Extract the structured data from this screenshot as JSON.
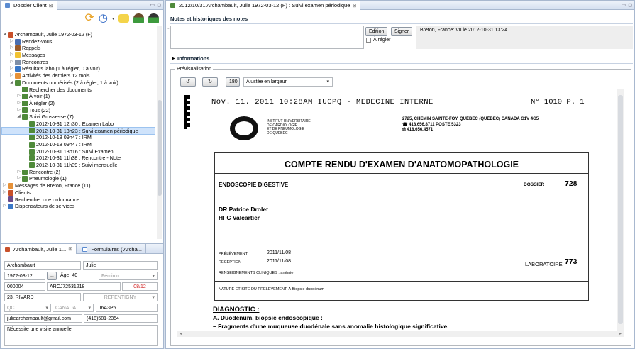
{
  "left_top": {
    "tab": "Dossier Client",
    "tab_close": "⊠",
    "tree": [
      {
        "depth": 0,
        "tw": "◢",
        "icon": "patient-icon",
        "color": "#c8502a",
        "label": "Archambault, Julie 1972-03-12 (F)"
      },
      {
        "depth": 1,
        "tw": "▷",
        "icon": "calendar-icon",
        "color": "#4a6fb1",
        "label": "Rendez-vous"
      },
      {
        "depth": 1,
        "tw": "▷",
        "icon": "pin-icon",
        "color": "#9a5b2a",
        "label": "Rappels"
      },
      {
        "depth": 1,
        "tw": "▷",
        "icon": "message-icon",
        "color": "#f1c232",
        "label": "Messages"
      },
      {
        "depth": 1,
        "tw": "▷",
        "icon": "calendar-icon",
        "color": "#7f8fa6",
        "label": "Rencontres"
      },
      {
        "depth": 1,
        "tw": "▷",
        "icon": "lab-icon",
        "color": "#3a78c7",
        "label": "Résultats labo (1 à régler, 0 à voir)"
      },
      {
        "depth": 1,
        "tw": "▷",
        "icon": "activity-icon",
        "color": "#e69138",
        "label": "Activités des derniers 12 mois"
      },
      {
        "depth": 1,
        "tw": "◢",
        "icon": "document-icon",
        "color": "#4f8a3a",
        "label": "Documents numérisés (2 à régler, 1 à voir)"
      },
      {
        "depth": 2,
        "tw": "",
        "icon": "search-document-icon",
        "color": "#4f8a3a",
        "label": "Rechercher des documents"
      },
      {
        "depth": 2,
        "tw": "▷",
        "icon": "document-icon",
        "color": "#4f8a3a",
        "label": "À voir (1)"
      },
      {
        "depth": 2,
        "tw": "▷",
        "icon": "document-icon",
        "color": "#4f8a3a",
        "label": "À régler (2)"
      },
      {
        "depth": 2,
        "tw": "▷",
        "icon": "document-icon",
        "color": "#4f8a3a",
        "label": "Tous (22)"
      },
      {
        "depth": 2,
        "tw": "◢",
        "icon": "document-icon",
        "color": "#4f8a3a",
        "label": "Suivi Grossesse (7)"
      },
      {
        "depth": 3,
        "tw": "",
        "icon": "document-icon",
        "color": "#4f8a3a",
        "label": "2012-10-31 12h30 : Examen Labo"
      },
      {
        "depth": 3,
        "tw": "",
        "icon": "document-icon",
        "color": "#4f8a3a",
        "label": "2012-10-31 13h23 : Suivi examen périodique",
        "selected": true
      },
      {
        "depth": 3,
        "tw": "",
        "icon": "document-icon",
        "color": "#4f8a3a",
        "label": "2012-10-18 09h47 : IRM"
      },
      {
        "depth": 3,
        "tw": "",
        "icon": "document-icon",
        "color": "#4f8a3a",
        "label": "2012-10-18 09h47 : IRM"
      },
      {
        "depth": 3,
        "tw": "",
        "icon": "document-icon",
        "color": "#4f8a3a",
        "label": "2012-10-31 13h16 : Suivi Examen"
      },
      {
        "depth": 3,
        "tw": "",
        "icon": "document-icon",
        "color": "#4f8a3a",
        "label": "2012-10-31 11h38 : Rencontre - Note"
      },
      {
        "depth": 3,
        "tw": "",
        "icon": "document-icon",
        "color": "#4f8a3a",
        "label": "2012-10-31 11h39 : Suivi mensuelle"
      },
      {
        "depth": 2,
        "tw": "▷",
        "icon": "document-icon",
        "color": "#4f8a3a",
        "label": "Rencontre (2)"
      },
      {
        "depth": 2,
        "tw": "▷",
        "icon": "document-icon",
        "color": "#4f8a3a",
        "label": "Pneumologie (1)"
      },
      {
        "depth": 0,
        "tw": "▷",
        "icon": "message-icon",
        "color": "#e69138",
        "label": "Messages de Breton, France (11)"
      },
      {
        "depth": 0,
        "tw": "▷",
        "icon": "clients-icon",
        "color": "#c8502a",
        "label": "Clients"
      },
      {
        "depth": 0,
        "tw": "",
        "icon": "prescription-icon",
        "color": "#6a4a8a",
        "label": "Rechercher une ordonnance"
      },
      {
        "depth": 0,
        "tw": "▷",
        "icon": "pharmacy-icon",
        "color": "#3a78c7",
        "label": "Dispensateurs de services"
      }
    ]
  },
  "left_bottom": {
    "tab1": "Archambault, Julie 1...",
    "tab2": "Formulaires ( Archa...",
    "lastname": "Archambault",
    "firstname": "Julie",
    "birthdate": "1972-03-12",
    "dots": "...",
    "age": "Âge: 40",
    "sex": "Féminin",
    "number": "000004",
    "ramq": "ARCJ72531218",
    "expiry": "08/12",
    "address": "23, RIVARD",
    "city": "REPENTIGNY",
    "province": "QC",
    "country": "CANADA",
    "postal": "J6A3P5",
    "email": "juliearchambault@gmail.com",
    "phone": "(418)581-2354",
    "note": "Nécessite une visite annuelle"
  },
  "main": {
    "tab": "2012/10/31 Archambault, Julie 1972-03-12 (F) : Suivi examen périodique",
    "notes_header": "Notes et historiques des notes",
    "edition": "Edition",
    "signer": "Signer",
    "a_regler": "À régler",
    "signature": "Breton, France: Vu le 2012-10-31 13:24",
    "informations": "Informations",
    "preview": "Prévisualisation",
    "zoom": "180",
    "fit": "Ajustée en largeur"
  },
  "document": {
    "fax_header": "Nov. 11. 2011  10:28AM    IUCPQ - MEDECINE INTERNE",
    "fax_page": "N° 1010   P. 1",
    "inst1": "INSTITUT UNIVERSITAIRE",
    "inst2": "DE CARDIOLOGIE",
    "inst3": "ET DE PNEUMOLOGIE",
    "inst4": "DE QUÉBEC",
    "addr1": "2725, CHEMIN SAINTE-FOY, QUÉBEC (QUÉBEC) CANADA G1V 4G5",
    "addr2": "☎ 418.656.8711 POSTE 5323",
    "addr3": "⎙ 418.656.4571",
    "title": "COMPTE RENDU D'EXAMEN D'ANATOMOPATHOLOGIE",
    "exam": "ENDOSCOPIE DIGESTIVE",
    "dossier_label": "DOSSIER",
    "dossier": "728",
    "doctor": "DR Patrice Drolet",
    "clinic": "HFC Valcartier",
    "prel_label": "PRÉLÈVEMENT",
    "prel_date": "2011/11/08",
    "recep_label": "RÉCEPTION",
    "recep_date": "2011/11/08",
    "lab_label": "LABORATOIRE",
    "lab": "773",
    "clinical": "RENSEIGNEMENTS CLINIQUES : anémie",
    "nature": "NATURE ET SITE DU PRÉLÈVEMENT: A Biopsie duodénum",
    "diag": "DIAGNOSTIC :",
    "diag_a": "A. Duodénum, biopsie endoscopique :",
    "diag_text": "–     Fragments d'une muqueuse duodénale sans anomalie histologique significative."
  }
}
